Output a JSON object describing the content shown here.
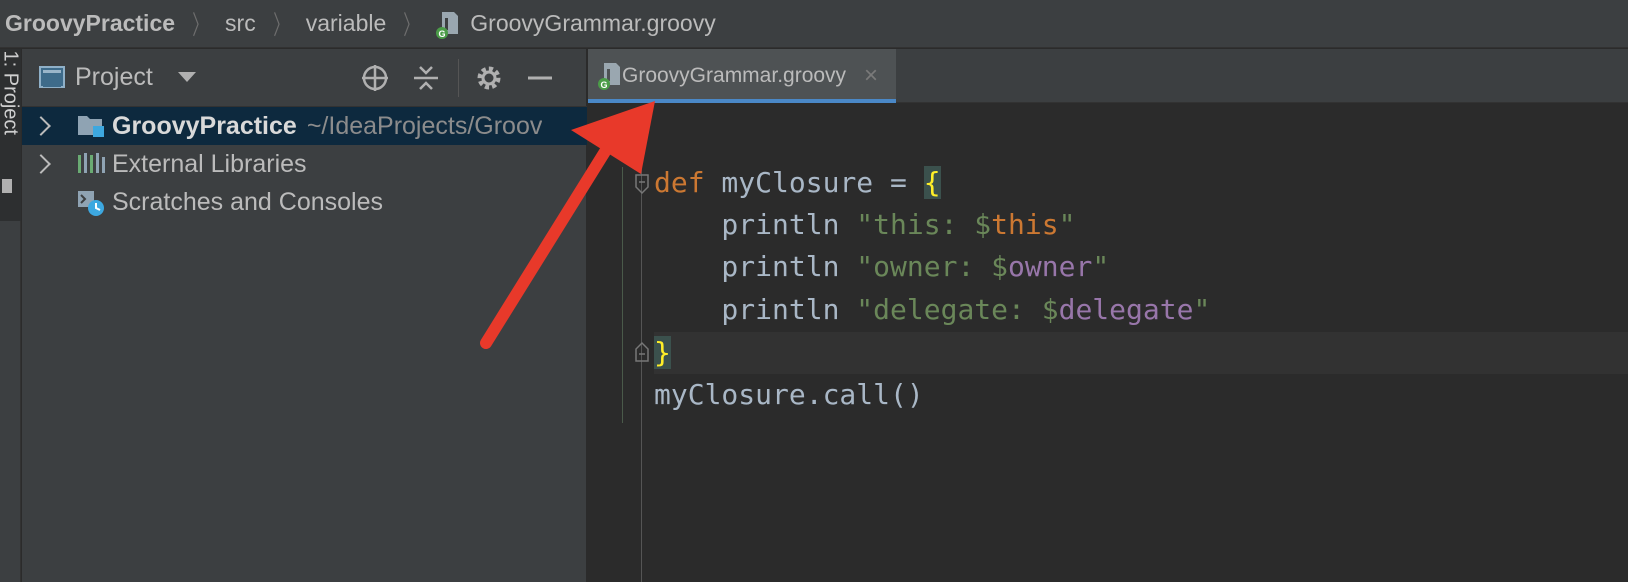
{
  "breadcrumb": {
    "items": [
      "GroovyPractice",
      "src",
      "variable",
      "GroovyGrammar.groovy"
    ]
  },
  "tool_strip": {
    "tab_label": "1: Project"
  },
  "project_panel": {
    "title": "Project",
    "tree": [
      {
        "label": "GroovyPractice",
        "path": "~/IdeaProjects/Groov",
        "expandable": true,
        "selected": true
      },
      {
        "label": "External Libraries",
        "expandable": true,
        "selected": false
      },
      {
        "label": "Scratches and Consoles",
        "expandable": false,
        "selected": false
      }
    ]
  },
  "editor": {
    "tab": {
      "label": "GroovyGrammar.groovy",
      "close": "×"
    },
    "code": {
      "line1": {
        "kw": "def",
        "name": " myClosure = ",
        "brace": "{"
      },
      "line2": {
        "indent": "    println ",
        "str_open": "\"this: $",
        "var": "this",
        "str_close": "\""
      },
      "line3": {
        "indent": "    println ",
        "str_open": "\"owner: $",
        "var": "owner",
        "str_close": "\""
      },
      "line4": {
        "indent": "    println ",
        "str_open": "\"delegate: $",
        "var": "delegate",
        "str_close": "\""
      },
      "line5": {
        "brace": "}"
      },
      "line6": {
        "text": "myClosure.call()"
      }
    }
  },
  "colors": {
    "keyword": "#cc7832",
    "string": "#6a8759",
    "variable": "#9876aa",
    "brace": "#ffef28",
    "annotation_arrow": "#e8392a",
    "tab_underline": "#4a88c7"
  },
  "icons": [
    "groovy-file-icon",
    "project-view-icon",
    "locate-icon",
    "collapse-all-icon",
    "gear-icon",
    "minimize-icon",
    "module-folder-icon",
    "libraries-icon",
    "scratches-icon",
    "close-icon",
    "fold-icon"
  ]
}
